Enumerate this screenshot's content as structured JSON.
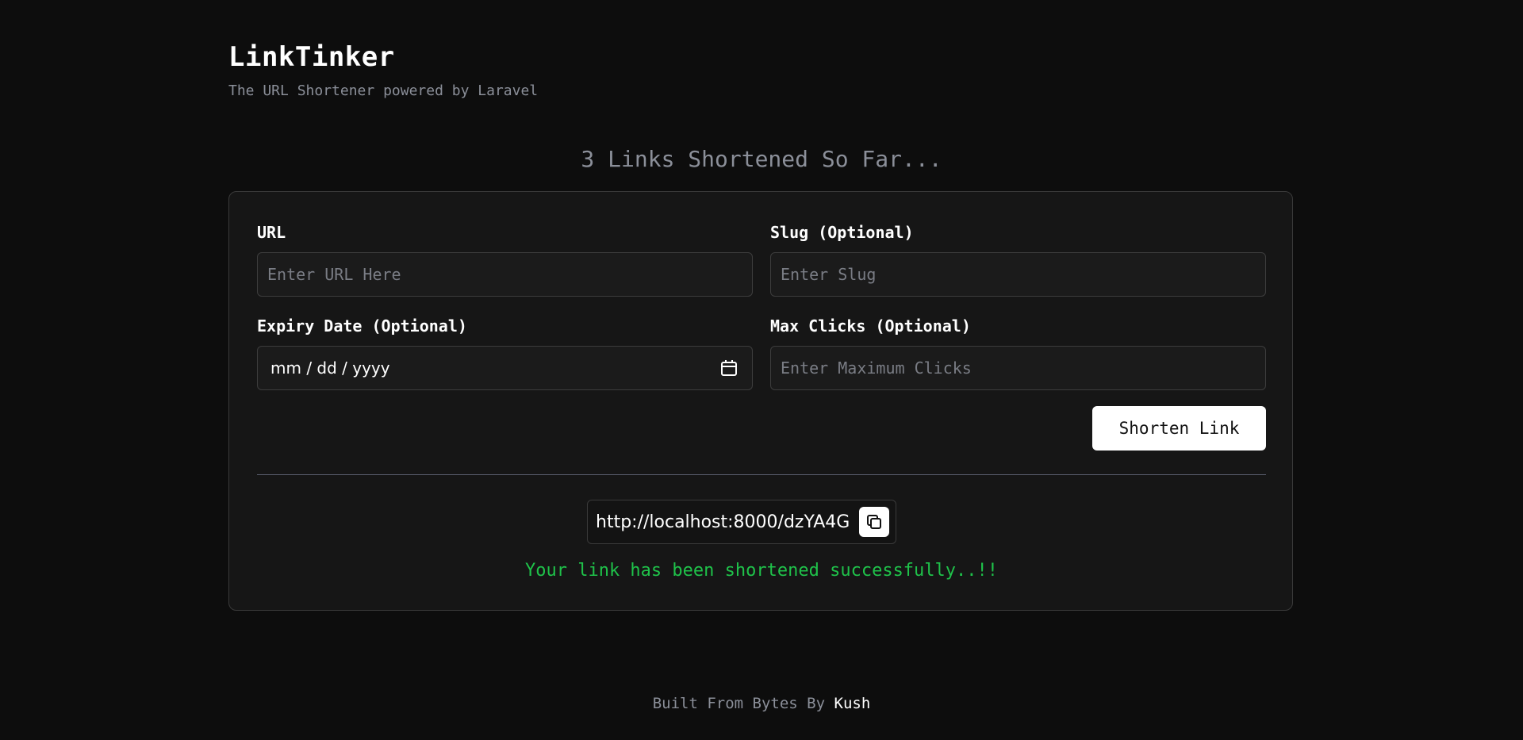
{
  "header": {
    "title": "LinkTinker",
    "subtitle": "The URL Shortener powered by Laravel"
  },
  "counter": {
    "text": "3 Links Shortened So Far..."
  },
  "form": {
    "url": {
      "label": "URL",
      "placeholder": "Enter URL Here",
      "value": ""
    },
    "slug": {
      "label": "Slug (Optional)",
      "placeholder": "Enter Slug",
      "value": ""
    },
    "expiry": {
      "label": "Expiry Date (Optional)",
      "placeholder": "mm / dd / yyyy",
      "icon": "calendar-icon"
    },
    "max_clicks": {
      "label": "Max Clicks (Optional)",
      "placeholder": "Enter Maximum Clicks",
      "value": ""
    },
    "submit_label": "Shorten Link"
  },
  "result": {
    "short_url": "http://localhost:8000/dzYA4G",
    "copy_icon": "copy-icon",
    "success_message": "Your link has been shortened successfully..!!"
  },
  "footer": {
    "prefix": "Built From Bytes By",
    "author": "Kush"
  },
  "colors": {
    "background": "#0d0d0d",
    "card": "#161616",
    "success": "#1fc24a",
    "muted": "#8b8f99"
  }
}
